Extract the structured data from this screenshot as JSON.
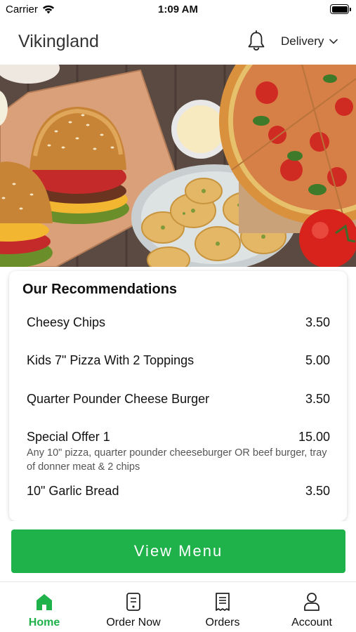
{
  "status_bar": {
    "carrier": "Carrier",
    "time": "1:09 AM"
  },
  "header": {
    "title": "Vikingland",
    "delivery_label": "Delivery"
  },
  "recommendations": {
    "title": "Our Recommendations",
    "items": [
      {
        "name": "Cheesy Chips",
        "price": "3.50",
        "description": ""
      },
      {
        "name": "Kids 7\" Pizza With 2 Toppings",
        "price": "5.00",
        "description": ""
      },
      {
        "name": "Quarter Pounder Cheese Burger",
        "price": "3.50",
        "description": ""
      },
      {
        "name": "Special Offer 1",
        "price": "15.00",
        "description": "Any 10\" pizza, quarter pounder cheeseburger OR beef burger, tray of donner meat & 2 chips"
      },
      {
        "name": "10\" Garlic Bread",
        "price": "3.50",
        "description": ""
      }
    ]
  },
  "view_menu_label": "View Menu",
  "tabs": [
    {
      "label": "Home",
      "icon": "home-icon",
      "active": true
    },
    {
      "label": "Order Now",
      "icon": "order-icon",
      "active": false
    },
    {
      "label": "Orders",
      "icon": "receipt-icon",
      "active": false
    },
    {
      "label": "Account",
      "icon": "person-icon",
      "active": false
    }
  ],
  "colors": {
    "accent": "#1fb14a",
    "text": "#111111",
    "muted": "#555555"
  }
}
